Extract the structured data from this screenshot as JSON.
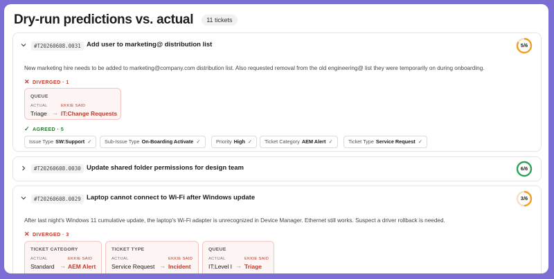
{
  "page": {
    "title": "Dry-run predictions vs. actual",
    "count_badge": "11 tickets"
  },
  "labels": {
    "actual": "ACTUAL",
    "ekkie": "EKKIE SAID"
  },
  "colors": {
    "diverged": "#c0392b",
    "agreed": "#2e7d32",
    "score_partial": "#f0a020",
    "score_full": "#2e9e5a"
  },
  "tickets": [
    {
      "id": "#T20260608.0031",
      "title": "Add user to marketing@ distribution list",
      "score": "5/6",
      "expanded": true,
      "description": "New marketing hire needs to be added to marketing@company.com distribution list. Also requested removal from the old engineering@ list they were temporarily on during onboarding.",
      "diverged_label": "DIVERGED · 1",
      "diverged": [
        {
          "field": "QUEUE",
          "actual": "Triage",
          "ekkie": "IT:Change Requests"
        }
      ],
      "agreed_label": "AGREED · 5",
      "agreed": [
        {
          "name": "Issue Type",
          "value": "SW:Support"
        },
        {
          "name": "Sub-Issue Type",
          "value": "On-Boarding Activate"
        },
        {
          "name": "Priority",
          "value": "High"
        },
        {
          "name": "Ticket Category",
          "value": "AEM Alert"
        },
        {
          "name": "Ticket Type",
          "value": "Service Request"
        }
      ]
    },
    {
      "id": "#T20260608.0030",
      "title": "Update shared folder permissions for design team",
      "score": "6/6",
      "expanded": false
    },
    {
      "id": "#T20260608.0029",
      "title": "Laptop cannot connect to Wi-Fi after Windows update",
      "score": "3/6",
      "expanded": true,
      "description": "After last night's Windows 11 cumulative update, the laptop's Wi-Fi adapter is unrecognized in Device Manager. Ethernet still works. Suspect a driver rollback is needed.",
      "diverged_label": "DIVERGED · 3",
      "diverged": [
        {
          "field": "TICKET CATEGORY",
          "actual": "Standard",
          "ekkie": "AEM Alert"
        },
        {
          "field": "TICKET TYPE",
          "actual": "Service Request",
          "ekkie": "Incident"
        },
        {
          "field": "QUEUE",
          "actual": "IT:Level I",
          "ekkie": "Triage"
        }
      ]
    }
  ]
}
